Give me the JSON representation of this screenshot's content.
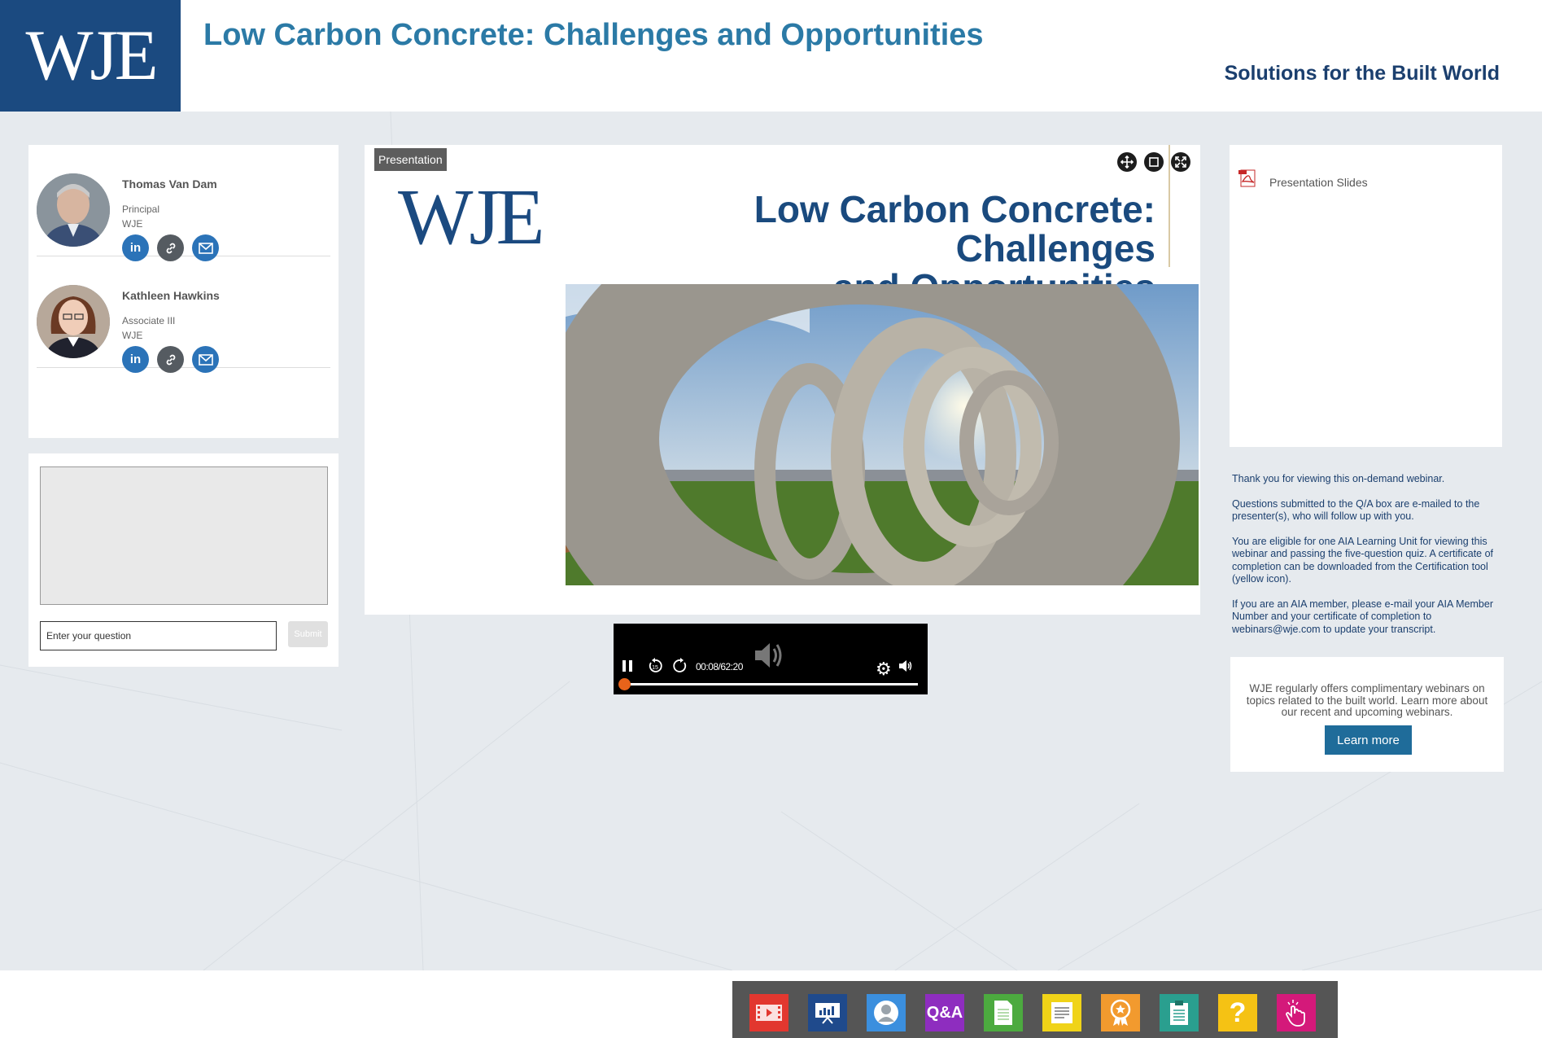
{
  "header": {
    "logo": "WJE",
    "title": "Low Carbon Concrete: Challenges and Opportunities",
    "tagline": "Solutions for the Built World"
  },
  "speakers": [
    {
      "name": "Thomas Van Dam",
      "role": "Principal",
      "org": "WJE",
      "links": [
        "linkedin-icon",
        "link-icon",
        "email-icon"
      ]
    },
    {
      "name": "Kathleen Hawkins",
      "role": "Associate III",
      "org": "WJE",
      "links": [
        "linkedin-icon",
        "link-icon",
        "email-icon"
      ]
    }
  ],
  "qa": {
    "placeholder": "Enter your question",
    "submit_label": "Submit"
  },
  "presentation": {
    "tag": "Presentation",
    "controls": [
      "move-icon",
      "window-icon",
      "fullscreen-icon"
    ],
    "slide": {
      "logo": "WJE",
      "title_line1": "Low Carbon Concrete: Challenges",
      "title_line2": "and Opportunities"
    }
  },
  "player": {
    "time": "00:08/62:20",
    "progress": 0.002,
    "state": "playing"
  },
  "resources": {
    "items": [
      {
        "icon": "pdf-icon",
        "label": "Presentation Slides"
      }
    ]
  },
  "info": {
    "p1": "Thank you for viewing this on-demand webinar.",
    "p2": "Questions submitted to the Q/A box are e-mailed to the presenter(s), who will follow up with you.",
    "p3": "You are eligible for one AIA Learning Unit for viewing this webinar and passing the five-question quiz. A certificate of completion can be downloaded from the Certification tool (yellow icon).",
    "p4": "If you are an AIA member, please e-mail your AIA Member Number and your certificate of completion to webinars@wje.com to update your transcript."
  },
  "promo": {
    "text": "WJE regularly offers complimentary webinars on topics related to the built world. Learn more about our recent and upcoming webinars.",
    "button": "Learn more"
  },
  "toolbar": {
    "tools": [
      {
        "name": "media-player-tool",
        "icon": "film-icon",
        "color": "#e2372f"
      },
      {
        "name": "slides-tool",
        "icon": "presentation-icon",
        "color": "#1f4a8c"
      },
      {
        "name": "speaker-bio-tool",
        "icon": "person-icon",
        "color": "#3b8fde"
      },
      {
        "name": "qa-tool",
        "icon": "qa-icon",
        "label": "Q&A",
        "color": "#8e2dbf"
      },
      {
        "name": "resources-tool",
        "icon": "document-icon",
        "color": "#4caa3f"
      },
      {
        "name": "notes-tool",
        "icon": "note-icon",
        "color": "#f0d318"
      },
      {
        "name": "certificate-tool",
        "icon": "certificate-icon",
        "color": "#f29a2e"
      },
      {
        "name": "survey-tool",
        "icon": "clipboard-icon",
        "color": "#2a9f8f"
      },
      {
        "name": "help-tool",
        "icon": "help-icon",
        "label": "?",
        "color": "#f5c214"
      },
      {
        "name": "engagement-tool",
        "icon": "hand-icon",
        "color": "#d4197a"
      }
    ]
  }
}
